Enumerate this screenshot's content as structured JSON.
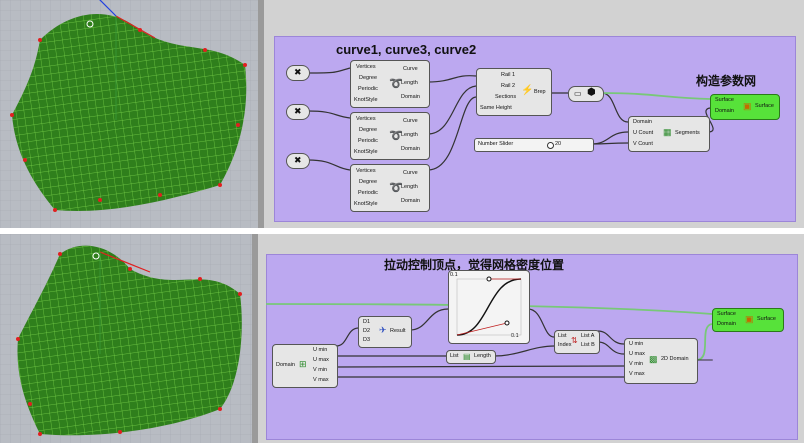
{
  "top": {
    "title_curves": "curve1, curve3, curve2",
    "title_param": "构造参数网",
    "curve_component": {
      "inputs": [
        "Vertices",
        "Degree",
        "Periodic",
        "KnotStyle"
      ],
      "outputs": [
        "Curve",
        "Length",
        "Domain"
      ]
    },
    "sweep": {
      "inputs": [
        "Rail 1",
        "Rail 2",
        "Sections",
        "Same Height"
      ],
      "output": "Brep"
    },
    "divide": {
      "inputs": [
        "Domain",
        "U Count",
        "V Count"
      ],
      "output": "Segments"
    },
    "slider": {
      "label": "Number Slider",
      "value": "20"
    },
    "surface": {
      "inputs": [
        "Surface",
        "Domain"
      ],
      "output": "Surface"
    }
  },
  "bottom": {
    "title": "拉动控制顶点，觉得网格密度位置",
    "domain_deconstruct": {
      "input": "Domain",
      "outputs": [
        "U min",
        "U max",
        "V min",
        "V max"
      ]
    },
    "merge": {
      "inputs": [
        "D1",
        "D2",
        "D3"
      ],
      "output": "Result"
    },
    "graph": {
      "tag_top": "0.1",
      "tag_bottom": "0.1"
    },
    "list_length": {
      "input": "List",
      "output": "Length"
    },
    "split": {
      "inputs": [
        "List",
        "Index"
      ],
      "outputs": [
        "List A",
        "List B"
      ]
    },
    "domain2d": {
      "inputs": [
        "U min",
        "U max",
        "V min",
        "V max"
      ],
      "output": "2D Domain"
    },
    "surface": {
      "inputs": [
        "Surface",
        "Domain"
      ],
      "output": "Surface"
    }
  },
  "colors": {
    "group": "#bca8f0",
    "surface_mesh": "#2e7a1a",
    "wire_green": "#78c878"
  }
}
